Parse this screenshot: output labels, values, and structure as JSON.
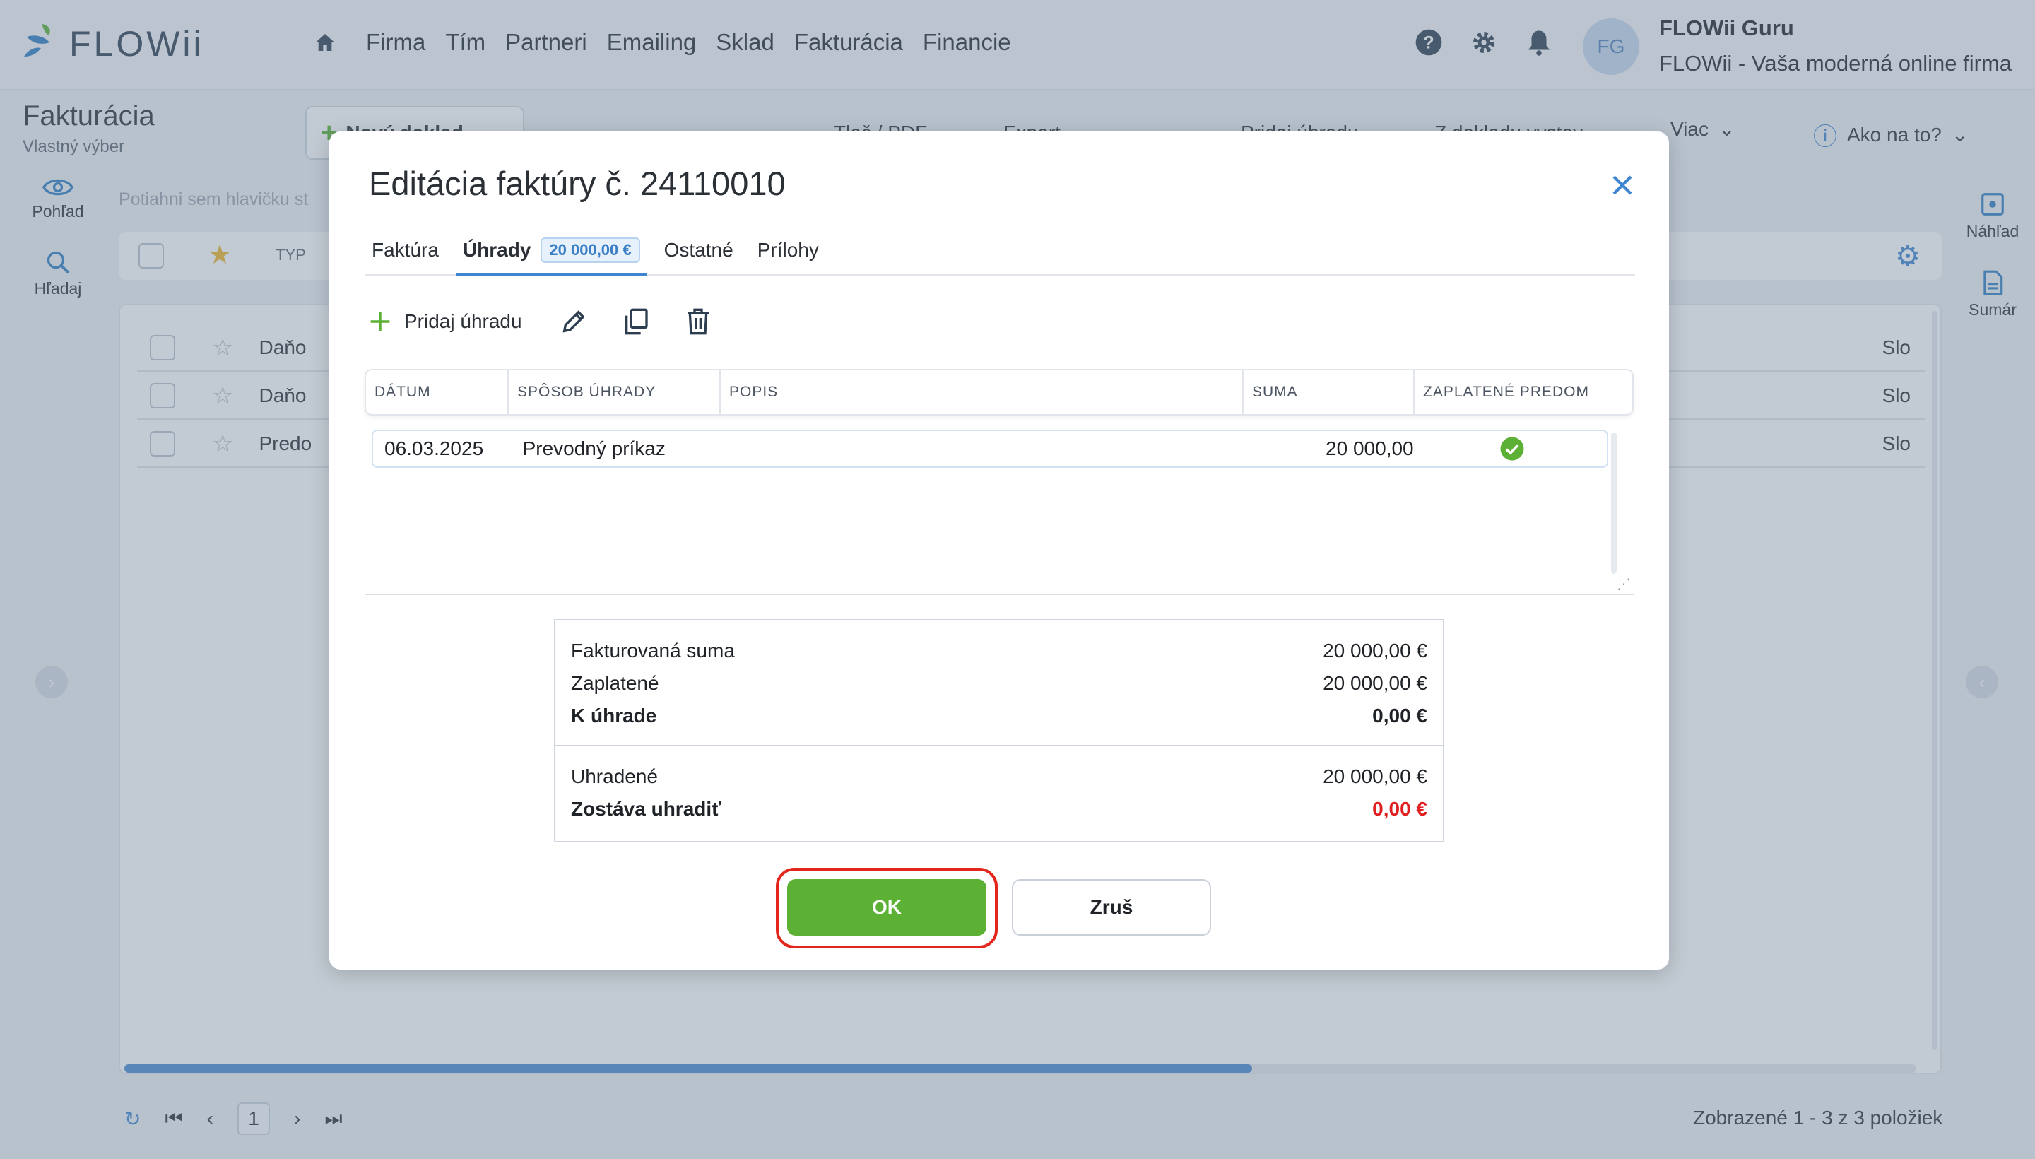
{
  "app": {
    "logo_text": "FLOWii"
  },
  "nav": {
    "items": [
      "Firma",
      "Tím",
      "Partneri",
      "Emailing",
      "Sklad",
      "Fakturácia",
      "Financie"
    ]
  },
  "user": {
    "initials": "FG",
    "name": "FLOWii Guru",
    "company": "FLOWii - Vaša moderná online firma"
  },
  "module": {
    "title": "Fakturácia",
    "subtitle": "Vlastný výber",
    "toolbar": {
      "new_doc": "Nový doklad",
      "print": "Tlač / PDF",
      "export": "Export",
      "add_payment": "Pridaj úhradu",
      "from_doc": "Z dokladu vystav",
      "more": "Viac",
      "help": "Ako na to?"
    }
  },
  "sidebar": {
    "left": [
      {
        "label": "Pohľad"
      },
      {
        "label": "Hľadaj"
      }
    ],
    "right": [
      {
        "label": "Náhľad"
      },
      {
        "label": "Sumár"
      }
    ]
  },
  "grid": {
    "drag_hint": "Potiahni sem hlavičku st",
    "type_label": "TYP",
    "rows": [
      {
        "label": "Daňo",
        "right": "Slo"
      },
      {
        "label": "Daňo",
        "right": "Slo"
      },
      {
        "label": "Predo",
        "right": "Slo"
      }
    ],
    "pager_page": "1",
    "pager_info": "Zobrazené 1 - 3 z 3 položiek"
  },
  "modal": {
    "title": "Editácia faktúry č. 24110010",
    "tabs": [
      {
        "label": "Faktúra"
      },
      {
        "label": "Úhrady",
        "badge": "20 000,00 €"
      },
      {
        "label": "Ostatné"
      },
      {
        "label": "Prílohy"
      }
    ],
    "add_payment_label": "Pridaj úhradu",
    "table": {
      "headers": [
        "DÁTUM",
        "SPÔSOB ÚHRADY",
        "POPIS",
        "SUMA",
        "ZAPLATENÉ PREDOM"
      ],
      "rows": [
        {
          "date": "06.03.2025",
          "method": "Prevodný príkaz",
          "description": "",
          "amount": "20 000,00",
          "prepaid": true
        }
      ]
    },
    "summary": {
      "invoiced_label": "Fakturovaná suma",
      "invoiced_value": "20 000,00 €",
      "paid_label": "Zaplatené",
      "paid_value": "20 000,00 €",
      "due_label": "K úhrade",
      "due_value": "0,00 €",
      "settled_label": "Uhradené",
      "settled_value": "20 000,00 €",
      "remaining_label": "Zostáva uhradiť",
      "remaining_value": "0,00 €"
    },
    "ok_label": "OK",
    "cancel_label": "Zruš"
  },
  "colors": {
    "accent": "#3f86d1",
    "ok": "#5cb135",
    "alert": "#e02020",
    "highlight_ring": "#e3261c"
  },
  "icons": [
    "home-icon",
    "help-icon",
    "gear-icon",
    "bell-icon",
    "eye-icon",
    "search-icon",
    "preview-icon",
    "summary-icon",
    "close-icon",
    "plus-icon",
    "pencil-icon",
    "copy-icon",
    "trash-icon",
    "check-icon"
  ]
}
